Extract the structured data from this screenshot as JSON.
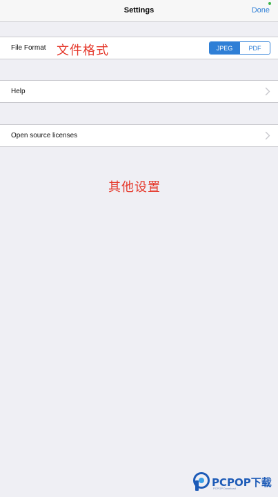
{
  "navbar": {
    "title": "Settings",
    "done_label": "Done"
  },
  "file_format": {
    "label": "File Format",
    "annotation": "文件格式",
    "options": [
      "JPEG",
      "PDF"
    ],
    "selected": "JPEG"
  },
  "help": {
    "label": "Help"
  },
  "licenses": {
    "label": "Open source licenses"
  },
  "annotation_other": "其他设置",
  "watermark": {
    "brand": "PCPOP下载",
    "tagline": "PCPOP Download"
  },
  "colors": {
    "accent": "#2f7fd6",
    "annotation": "#e5382b",
    "background": "#efeff4"
  }
}
